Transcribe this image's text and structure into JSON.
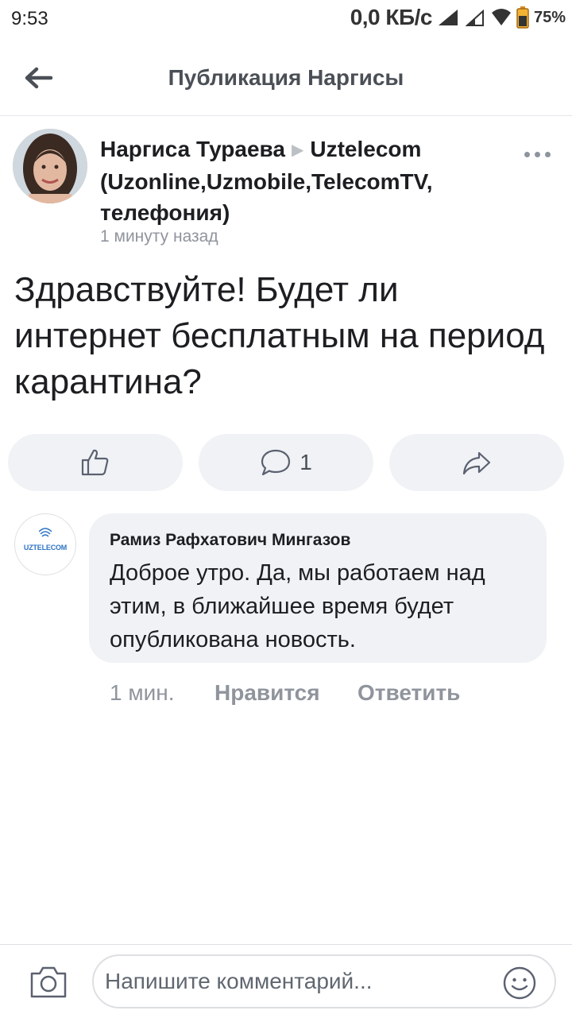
{
  "status_bar": {
    "time": "9:53",
    "net_speed": "0,0 КБ/с",
    "battery": "75%"
  },
  "header": {
    "title": "Публикация Наргисы",
    "back_icon": "arrow-left-icon"
  },
  "post": {
    "author": "Наргиса Тураева",
    "target": "Uztelecom (Uzonline,Uzmobile,TelecomTV, телефония)",
    "time": "1 минуту назад",
    "text": "Здравствуйте! Будет ли интернет бесплатным на период карантина?",
    "actions": {
      "like_icon": "thumbs-up-icon",
      "comment_icon": "comment-icon",
      "comment_count": "1",
      "share_icon": "share-icon"
    }
  },
  "comment": {
    "avatar_logo": "UZTELECOM",
    "author": "Рамиз Рафхатович Мингазов",
    "text": "Доброе утро. Да, мы работаем над этим, в ближайшее время будет опубликована новость.",
    "time": "1 мин.",
    "like_label": "Нравится",
    "reply_label": "Ответить"
  },
  "composer": {
    "placeholder": "Напишите комментарий...",
    "camera_icon": "camera-icon",
    "emoji_icon": "emoji-icon"
  },
  "colors": {
    "pill_bg": "#f0f2f5",
    "secondary_text": "#90949c",
    "logo_blue": "#2d74c4"
  }
}
